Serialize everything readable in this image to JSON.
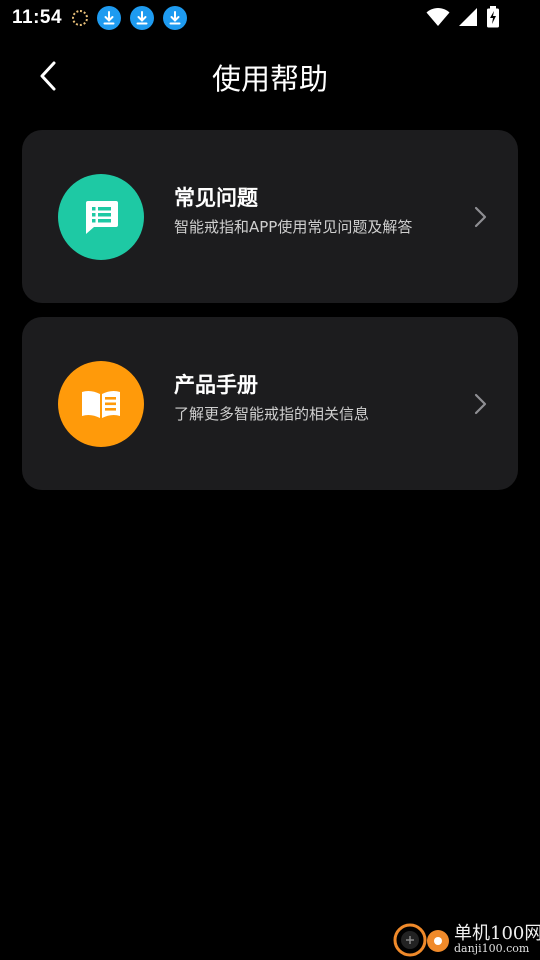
{
  "status_bar": {
    "time": "11:54",
    "icons": [
      "sync-ring-icon",
      "download-icon",
      "download-icon",
      "download-icon",
      "wifi-icon",
      "cell-signal-icon",
      "battery-charging-icon"
    ]
  },
  "header": {
    "title": "使用帮助",
    "back_icon": "chevron-left-icon"
  },
  "cards": [
    {
      "title": "常见问题",
      "subtitle": "智能戒指和APP使用常见问题及解答",
      "icon": "chat-list-icon",
      "icon_bg": "#1ec9a4"
    },
    {
      "title": "产品手册",
      "subtitle": "了解更多智能戒指的相关信息",
      "icon": "open-book-icon",
      "icon_bg": "#ff9a0a"
    }
  ],
  "colors": {
    "background": "#000000",
    "card_bg": "#1c1c1e",
    "download_badge": "#1e9bf0"
  },
  "watermark": {
    "name": "单机100网",
    "url": "danji100.com"
  }
}
